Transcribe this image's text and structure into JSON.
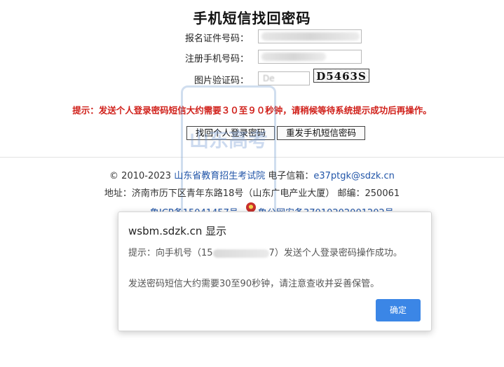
{
  "page": {
    "title": "手机短信找回密码",
    "form": {
      "id_label": "报名证件号码：",
      "phone_label": "注册手机号码：",
      "captcha_label": "图片验证码：",
      "captcha_input_value": "De",
      "captcha_image_text": "D5463S"
    },
    "hint": "提示：发送个人登录密码短信大约需要３０至９０秒钟，请稍候等待系统提示成功后再操作。",
    "buttons": {
      "recover": "找回个人登录密码",
      "resend": "重发手机短信密码"
    },
    "footer": {
      "copyright_prefix": "© 2010-2023",
      "org_link": "山东省教育招生考试院",
      "email_label": "电子信箱：",
      "email": "e37ptgk@sdzk.cn",
      "address": "地址：济南市历下区青年东路18号（山东广电产业大厦） 邮编：250061",
      "icp": "鲁ICP备15041457号",
      "police": "鲁公网安备37010202001202号"
    },
    "watermark": "山东高考"
  },
  "dialog": {
    "title": "wsbm.sdzk.cn 显示",
    "line1_prefix": "提示：向手机号（15",
    "line1_suffix": "7）发送个人登录密码操作成功。",
    "line2": "发送密码短信大约需要30至90秒钟，请注意查收并妥善保管。",
    "ok_label": "确定"
  },
  "colors": {
    "hint_red": "#d0201a",
    "link_blue": "#2155a8",
    "ok_button": "#3b86e6"
  }
}
